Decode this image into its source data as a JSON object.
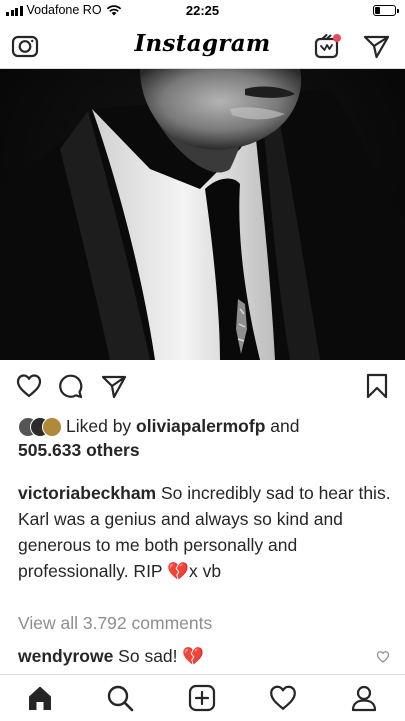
{
  "status_bar": {
    "carrier": "Vodafone RO",
    "time": "22:25",
    "signal_bars": 4,
    "battery_level": 0.25
  },
  "header": {
    "logo": "Instagram",
    "icons": [
      "camera-icon",
      "igtv-icon",
      "direct-message-icon"
    ]
  },
  "post": {
    "image": "black-and-white portrait photo",
    "actions": [
      "heart-icon",
      "comment-icon",
      "share-icon",
      "bookmark-icon"
    ],
    "likes": {
      "prefix": "Liked by ",
      "user": "oliviapalermofp",
      "middle": " and",
      "count": "505.633 others"
    },
    "caption": {
      "username": "victoriabeckham",
      "text": " So incredibly sad to hear this. Karl was a genius and always so kind and generous to me both personally and professionally. RIP ",
      "emoji": "💔",
      "tail": "x vb"
    },
    "view_all_comments": "View all 3.792 comments",
    "comment": {
      "username": "wendyrowe",
      "text": " So sad! ",
      "emoji": "💔"
    }
  },
  "tab_bar": {
    "items": [
      "home-icon",
      "search-icon",
      "new-post-icon",
      "activity-icon",
      "profile-icon"
    ]
  },
  "colors": {
    "text": "#262626",
    "muted": "#8e8e8e",
    "divider": "#dbdbdb",
    "heartbreak": "#e0245e",
    "igtv_badge": "#ed4956"
  }
}
